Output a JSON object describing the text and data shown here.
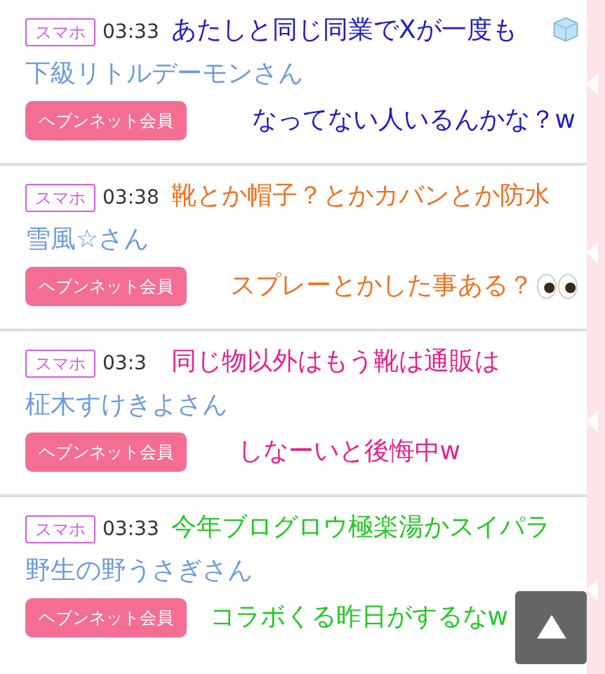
{
  "posts": [
    {
      "badge": "スマホ",
      "time": "03:33",
      "name": "下級リトルデーモンさん",
      "button": "ヘブンネット会員",
      "comment": {
        "lines": [
          "あたしと同じ同業でXが一度も",
          "なってない人いるんかな？w"
        ],
        "color": "#1c1cc8"
      }
    },
    {
      "badge": "スマホ",
      "time": "03:38",
      "name": "雪風☆さん",
      "button": "ヘブンネット会員",
      "comment": {
        "lines": [
          "靴とか帽子？とかカバンとか防水",
          "スプレーとかした事ある？"
        ],
        "color": "#f07020"
      }
    },
    {
      "badge": "スマホ",
      "time": "03:3",
      "name": "柾木すけきよさん",
      "button": "ヘブンネット会員",
      "comment": {
        "lines": [
          "同じ物以外はもう靴は通販は",
          "しなーいと後悔中w"
        ],
        "color": "#e8208a"
      }
    },
    {
      "badge": "スマホ",
      "time": "03:33",
      "name": "野生の野うさぎさん",
      "button": "ヘブンネット会員",
      "comment": {
        "lines": [
          "今年ブログロウ極楽湯かスイパラ",
          "コラボくる昨日がするなw"
        ],
        "color": "#22c822"
      }
    }
  ]
}
